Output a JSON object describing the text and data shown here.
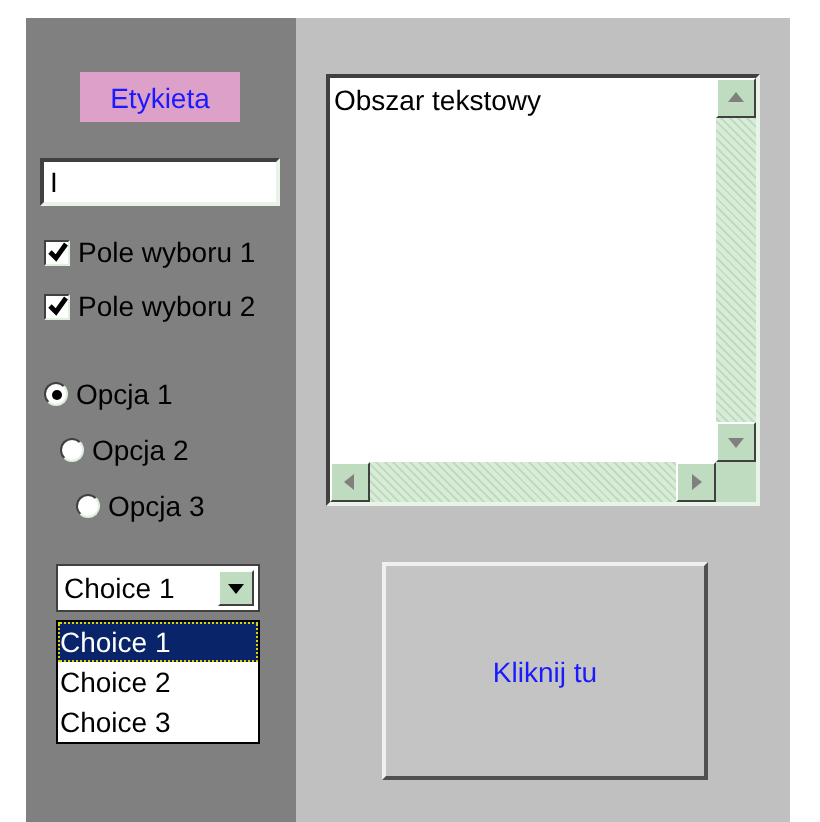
{
  "label": "Etykieta",
  "text_field": {
    "value": "I"
  },
  "checkboxes": [
    {
      "label": "Pole wyboru 1",
      "checked": true
    },
    {
      "label": "Pole wyboru 2",
      "checked": true
    }
  ],
  "radios": [
    {
      "label": "Opcja 1",
      "selected": true
    },
    {
      "label": "Opcja 2",
      "selected": false
    },
    {
      "label": "Opcja 3",
      "selected": false
    }
  ],
  "dropdown": {
    "value": "Choice 1",
    "expanded": true,
    "options": [
      {
        "label": "Choice 1",
        "selected": true
      },
      {
        "label": "Choice 2",
        "selected": false
      },
      {
        "label": "Choice 3",
        "selected": false
      }
    ]
  },
  "text_area": {
    "value": "Obszar tekstowy"
  },
  "button": {
    "label": "Kliknij tu"
  }
}
